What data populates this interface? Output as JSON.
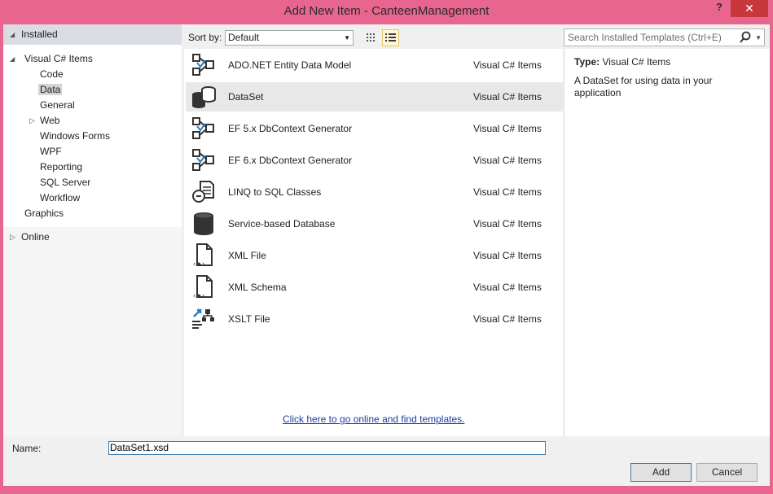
{
  "window": {
    "title": "Add New Item - CanteenManagement",
    "help_label": "?",
    "close_label": "✕"
  },
  "tree": {
    "installed_label": "Installed",
    "nodes": [
      {
        "label": "Visual C# Items",
        "expand": "◢"
      },
      {
        "label": "Code"
      },
      {
        "label": "Data",
        "selected": true
      },
      {
        "label": "General"
      },
      {
        "label": "Web",
        "expand": "▷"
      },
      {
        "label": "Windows Forms"
      },
      {
        "label": "WPF"
      },
      {
        "label": "Reporting"
      },
      {
        "label": "SQL Server"
      },
      {
        "label": "Workflow"
      },
      {
        "label": "Graphics"
      }
    ],
    "online_label": "Online"
  },
  "toolbar": {
    "sort_label": "Sort by:",
    "sort_value": "Default",
    "grid_view_icon": "medium-icons-view-icon",
    "list_view_icon": "list-view-icon"
  },
  "items": [
    {
      "name": "ADO.NET Entity Data Model",
      "category": "Visual C# Items",
      "icon": "entity-model-icon"
    },
    {
      "name": "DataSet",
      "category": "Visual C# Items",
      "icon": "dataset-icon",
      "selected": true
    },
    {
      "name": "EF 5.x DbContext Generator",
      "category": "Visual C# Items",
      "icon": "entity-model-icon"
    },
    {
      "name": "EF 6.x DbContext Generator",
      "category": "Visual C# Items",
      "icon": "entity-model-icon"
    },
    {
      "name": "LINQ to SQL Classes",
      "category": "Visual C# Items",
      "icon": "linq-icon"
    },
    {
      "name": "Service-based Database",
      "category": "Visual C# Items",
      "icon": "database-icon"
    },
    {
      "name": "XML File",
      "category": "Visual C# Items",
      "icon": "xml-file-icon"
    },
    {
      "name": "XML Schema",
      "category": "Visual C# Items",
      "icon": "xml-file-icon"
    },
    {
      "name": "XSLT File",
      "category": "Visual C# Items",
      "icon": "xslt-icon"
    }
  ],
  "online_link": "Click here to go online and find templates.",
  "search": {
    "placeholder": "Search Installed Templates (Ctrl+E)"
  },
  "details": {
    "type_label": "Type:",
    "type_value": "Visual C# Items",
    "description": "A DataSet for using data in your application"
  },
  "footer": {
    "name_label": "Name:",
    "name_value": "DataSet1.xsd",
    "add_label": "Add",
    "cancel_label": "Cancel"
  },
  "colors": {
    "title_bar": "#e8658f",
    "close_button": "#c7383c",
    "selection": "#e8e8e8",
    "link": "#1b3fa3"
  }
}
